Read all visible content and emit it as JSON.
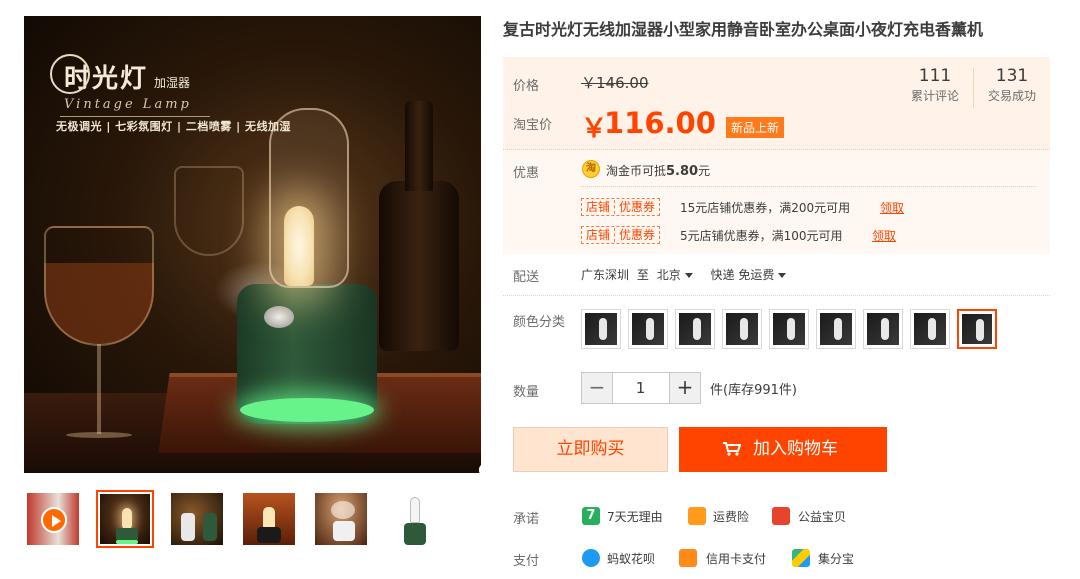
{
  "product": {
    "title": "复古时光灯无线加湿器小型家用静音卧室办公桌面小夜灯充电香薰机"
  },
  "gallery": {
    "image_text": {
      "brand_cn": "时光灯",
      "brand_sub": "加湿器",
      "brand_en": "Vintage Lamp",
      "features": "无极调光 | 七彩氛围灯 | 二档喷雾 | 无线加湿"
    },
    "thumbnails": [
      "video",
      "lamp-green-glow",
      "lamp-white-dark",
      "lamp-red-table",
      "lamp-white-mist",
      "lamp-green-plain"
    ],
    "active_thumbnail": 1,
    "colors": {
      "accent": "#ff4400"
    }
  },
  "price": {
    "orig_label": "价格",
    "orig_value": "￥146.00",
    "current_label": "淘宝价",
    "currency": "￥",
    "current_value": "116.00",
    "badge": "新品上新"
  },
  "stats": {
    "reviews_count": "111",
    "reviews_label": "累计评论",
    "sales_count": "131",
    "sales_label": "交易成功"
  },
  "promo": {
    "label": "优惠",
    "coin_icon": "淘",
    "coin_text": "淘金币可抵",
    "coin_amount": "5.80",
    "coin_unit": "元",
    "coupons": [
      {
        "shop": "店铺",
        "type": "优惠券",
        "desc": "15元店铺优惠券，满200元可用",
        "claim": "领取"
      },
      {
        "shop": "店铺",
        "type": "优惠券",
        "desc": "5元店铺优惠券，满100元可用",
        "claim": "领取"
      }
    ]
  },
  "shipping": {
    "label": "配送",
    "from": "广东深圳",
    "to_word": "至",
    "to": "北京",
    "method": "快递 免运费"
  },
  "color": {
    "label": "颜色分类",
    "swatch_count": 9,
    "selected_index": 8
  },
  "quantity": {
    "label": "数量",
    "minus": "−",
    "value": "1",
    "plus": "+",
    "stock": "件(库存991件)"
  },
  "actions": {
    "buy_now": "立即购买",
    "add_to_cart": "加入购物车"
  },
  "promise": {
    "label": "承诺",
    "items": [
      {
        "icon": "7",
        "text": "7天无理由"
      },
      {
        "icon": "freight-insurance-icon",
        "text": "运费险"
      },
      {
        "icon": "charity-icon",
        "text": "公益宝贝"
      }
    ]
  },
  "payment": {
    "label": "支付",
    "items": [
      {
        "icon": "huabei-icon",
        "text": "蚂蚁花呗"
      },
      {
        "icon": "credit-card-icon",
        "text": "信用卡支付"
      },
      {
        "icon": "jifenbao-icon",
        "text": "集分宝"
      }
    ]
  }
}
